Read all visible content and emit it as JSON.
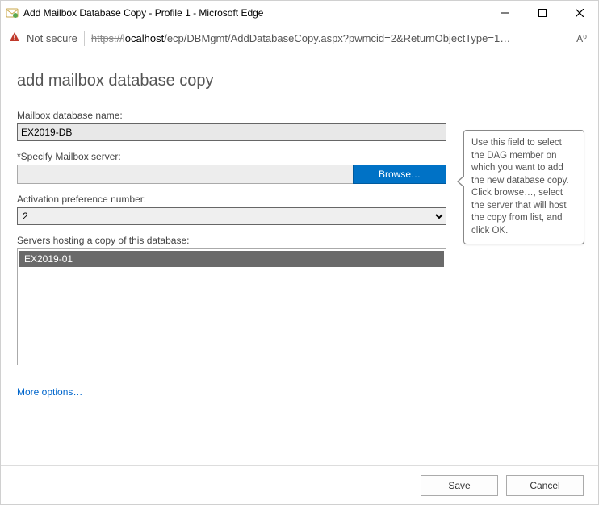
{
  "window": {
    "title": "Add Mailbox Database Copy - Profile 1 - Microsoft Edge"
  },
  "address": {
    "not_secure": "Not secure",
    "url_scheme": "https://",
    "url_host": "localhost",
    "url_path": "/ecp/DBMgmt/AddDatabaseCopy.aspx?pwmcid=2&ReturnObjectType=1…",
    "aa": "A⁰"
  },
  "page": {
    "heading": "add mailbox database copy",
    "db_label": "Mailbox database name:",
    "db_value": "EX2019-DB",
    "server_label": "*Specify Mailbox server:",
    "server_value": "",
    "browse": "Browse…",
    "activation_label": "Activation preference number:",
    "activation_value": "2",
    "servers_hosting_label": "Servers hosting a copy of this database:",
    "servers_list": [
      "EX2019-01"
    ],
    "more_options": "More options…"
  },
  "callout": {
    "text": "Use this field to select the DAG member on which you want to add the new database copy. Click browse…, select the server that will host the copy from list, and click OK."
  },
  "footer": {
    "save": "Save",
    "cancel": "Cancel"
  }
}
